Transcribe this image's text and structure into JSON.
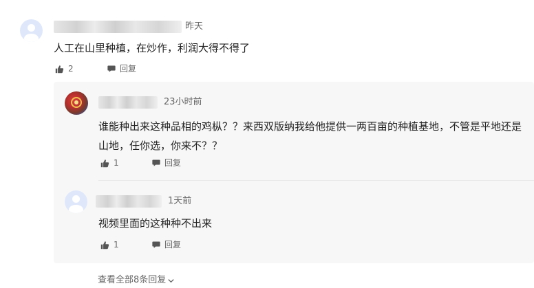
{
  "comment": {
    "time": "昨天",
    "content": "人工在山里种植，在炒作，利润大得不得了",
    "like_count": "2",
    "reply_label": "回复"
  },
  "replies": [
    {
      "time": "23小时前",
      "content": "谁能种出来这种品相的鸡枞？？来西双版纳我给他提供一两百亩的种植基地，不管是平地还是山地，任你选，你来不？？",
      "like_count": "1",
      "reply_label": "回复"
    },
    {
      "time": "1天前",
      "content": "视频里面的这种种不出来",
      "like_count": "1",
      "reply_label": "回复"
    }
  ],
  "view_all_label": "查看全部8条回复",
  "colors": {
    "text": "#222222",
    "meta": "#666666",
    "reply_bg": "#f7f7f7",
    "avatar_default": "#dfe8fb"
  }
}
